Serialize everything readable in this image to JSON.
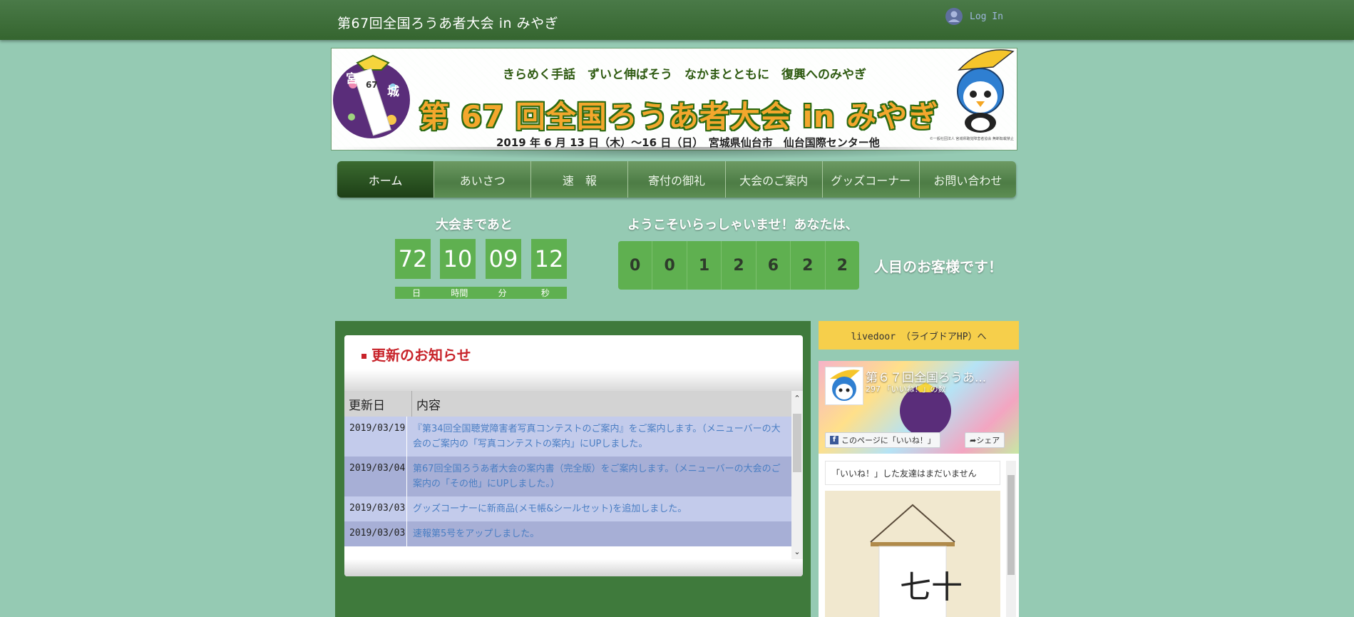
{
  "header": {
    "site_title": "第67回全国ろうあ者大会 in みやぎ",
    "login_label": "Log In"
  },
  "banner": {
    "slogan": "きらめく手話　ずいと伸ばそう　なかまとともに　復興へのみやぎ",
    "headline": "第 67 回全国ろうあ者大会 in みやぎ",
    "dates": "2019 年 6 月 13 日（木）〜16 日（日）　宮城県仙台市　仙台国際センター他",
    "logo_text": [
      "宮",
      "67",
      "城"
    ],
    "colors": {
      "headline": "#f3a72d",
      "outline": "#2b6a12"
    }
  },
  "nav": {
    "items": [
      {
        "label": "ホーム"
      },
      {
        "label": "あいさつ"
      },
      {
        "label": "速　報"
      },
      {
        "label": "寄付の御礼"
      },
      {
        "label": "大会のご案内"
      },
      {
        "label": "グッズコーナー"
      },
      {
        "label": "お問い合わせ"
      }
    ]
  },
  "countdown": {
    "title": "大会まであと",
    "values": [
      "72",
      "10",
      "09",
      "12"
    ],
    "labels": [
      "日",
      "時間",
      "分",
      "秒"
    ]
  },
  "visitor": {
    "welcome": "ようこそいらっしゃいませ！あなたは、",
    "digits": [
      "0",
      "0",
      "1",
      "2",
      "6",
      "2",
      "2"
    ],
    "suffix": "人目のお客様です！"
  },
  "news": {
    "heading": "更新のお知らせ",
    "col_date": "更新日",
    "col_content": "内容",
    "rows": [
      {
        "date": "2019/03/19",
        "text": "『第34回全国聴覚障害者写真コンテストのご案内』をご案内します。（メニューバーの大会のご案内の「写真コンテストの案内」にUPしました。"
      },
      {
        "date": "2019/03/04",
        "text": "第67回全国ろうあ者大会の案内書（完全版）をご案内します。（メニューバーの大会のご案内の「その他」にUPしました。）"
      },
      {
        "date": "2019/03/03",
        "text": "グッズコーナーに新商品(メモ帳&シールセット)を追加しました。"
      },
      {
        "date": "2019/03/03",
        "text": "速報第5号をアップしました。"
      }
    ]
  },
  "sidebar": {
    "livedoor_label": "livedoor （ライブドアHP）へ",
    "fb": {
      "page_name": "第６７回全国ろうあ...",
      "likes": "297 「いいね！」の数",
      "like_button": "このページに「いいね！」",
      "share_button": "シェア",
      "friends_text": "「いいね！」した友達はまだいません",
      "photo_text": "七十"
    }
  }
}
